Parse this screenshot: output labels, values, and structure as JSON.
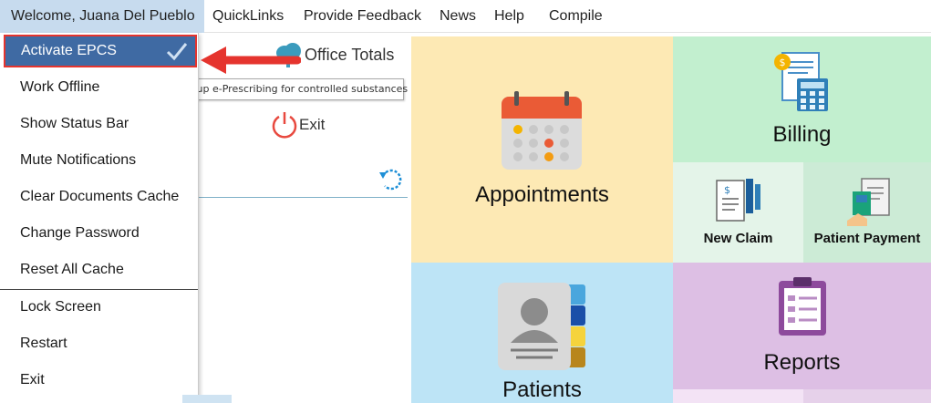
{
  "menubar": {
    "welcome": "Welcome, Juana Del Pueblo",
    "items": [
      {
        "label": "QuickLinks"
      },
      {
        "label": "Provide Feedback"
      },
      {
        "label": "News"
      },
      {
        "label": "Help"
      },
      {
        "label": "Compile"
      }
    ]
  },
  "dropdown": {
    "items": [
      {
        "label": "Activate EPCS",
        "selected": true
      },
      {
        "label": "Work Offline"
      },
      {
        "label": "Show Status Bar"
      },
      {
        "label": "Mute Notifications"
      },
      {
        "label": "Clear Documents Cache"
      },
      {
        "label": "Change Password"
      },
      {
        "label": "Reset All Cache"
      },
      {
        "label": "Lock Screen"
      },
      {
        "label": "Restart"
      },
      {
        "label": "Exit"
      }
    ]
  },
  "tooltip": {
    "text": "Set up e-Prescribing for controlled substances"
  },
  "sidebar": {
    "office_totals": "Office Totals",
    "exit": "Exit"
  },
  "tiles": {
    "appointments": "Appointments",
    "billing": "Billing",
    "new_claim": "New Claim",
    "patient_payment": "Patient Payment",
    "patients": "Patients",
    "reports": "Reports"
  },
  "colors": {
    "menu_highlight": "#3f6aa3",
    "callout_red": "#e5342e",
    "welcome_bg": "#c7dbee",
    "appointments_tile": "#fde9b4",
    "billing_tile": "#c2efcf",
    "patients_tile": "#bde4f6",
    "reports_tile": "#ddbfe4"
  },
  "icons": [
    "checkmark-icon",
    "callout-arrow-icon",
    "cloud-icon",
    "power-icon",
    "refresh-icon",
    "calendar-icon",
    "billing-icon",
    "new-claim-icon",
    "patient-payment-icon",
    "contact-book-icon",
    "clipboard-icon"
  ]
}
